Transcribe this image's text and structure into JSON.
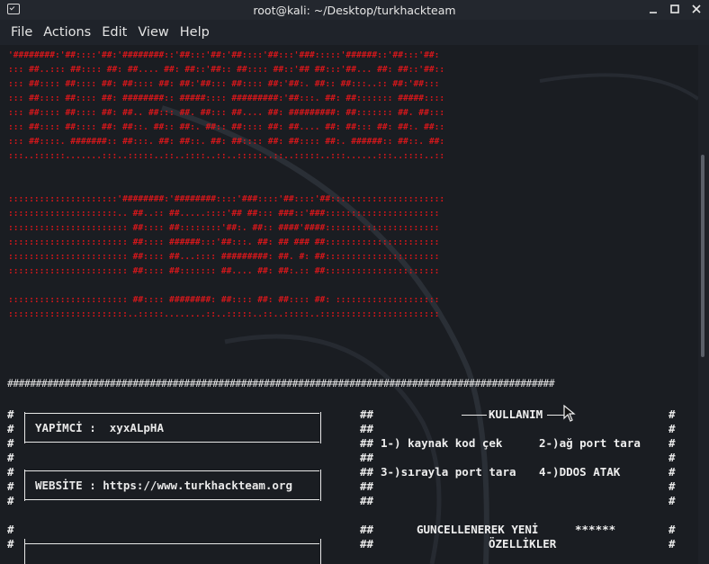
{
  "window": {
    "title": "root@kali: ~/Desktop/turkhackteam"
  },
  "menu": {
    "items": [
      "File",
      "Actions",
      "Edit",
      "View",
      "Help"
    ]
  },
  "banner": {
    "lines": [
      "'########:'##::::'##:'########::'##:::'##:'##::::'##:::'###:::::'######::'##:::'##:",
      "::: ##..::: ##:::: ##: ##.... ##: ##::'##:: ##:::: ##::'## ##:::'##... ##: ##::'##::",
      "::: ##:::: ##:::: ##: ##:::: ##: ##:'##::: ##:::: ##:'##:. ##:: ##:::..:: ##:'##:::",
      "::: ##:::: ##:::: ##: ########:: #####:::: #########:'##:::. ##: ##::::::: #####::::",
      "::: ##:::: ##:::: ##: ##.. ##::: ##. ##::: ##.... ##: #########: ##::::::: ##. ##:::",
      "::: ##:::: ##:::: ##: ##::. ##:: ##:. ##:: ##:::: ##: ##.... ##: ##::: ##: ##:. ##::",
      "::: ##::::. #######:: ##:::. ##: ##::. ##: ##:::: ##: ##:::: ##:. ######:: ##::. ##:",
      ":::..::::::.......:::..:::::..::..::::..::..:::::..::..:::::..:::......:::..::::..::",
      "",
      "",
      ":::::::::::::::::::::'########:'########::::'###::::'##::::'##::::::::::::::::::::::",
      ":::::::::::::::::::::.. ##..:: ##.....::::'## ##::: ###::'###::::::::::::::::::::::",
      "::::::::::::::::::::::: ##:::: ##::::::::'##:. ##:: ####'####::::::::::::::::::::::",
      "::::::::::::::::::::::: ##:::: ######:::'##:::. ##: ## ### ##::::::::::::::::::::::",
      "::::::::::::::::::::::: ##:::: ##...:::: #########: ##. #: ##::::::::::::::::::::::",
      "::::::::::::::::::::::: ##:::: ##::::::: ##.... ##: ##:.:: ##::::::::::::::::::::::",
      "",
      "::::::::::::::::::::::: ##:::: ########: ##:::: ##: ##:::: ##: ::::::::::::::::::::",
      ":::::::::::::::::::::::..:::::........::..:::::..::..:::::..:::::::::::::::::::::::"
    ]
  },
  "separator": "################################################################################################",
  "left_panel": {
    "hash": "#",
    "maker": "YAPİMCİ :  xyxALpHA",
    "website": "WEBSİTE : https://www.turkhackteam.org"
  },
  "right_panel": {
    "hash_pair": "##",
    "hash_end": "#",
    "usage_title": "KULLANIM",
    "option1": "1-) kaynak kod çek",
    "option2": "2-)ağ port tara",
    "option3": "3-)sırayla port tara",
    "option4": "4-)DDOS ATAK",
    "update_line1": "GUNCELLENEREK YENİ",
    "update_stars": "******",
    "update_line2": "ÖZELLİKLER"
  },
  "colors": {
    "banner": "#d3171b",
    "text": "#e8e8e8",
    "background": "#1a1d22"
  }
}
